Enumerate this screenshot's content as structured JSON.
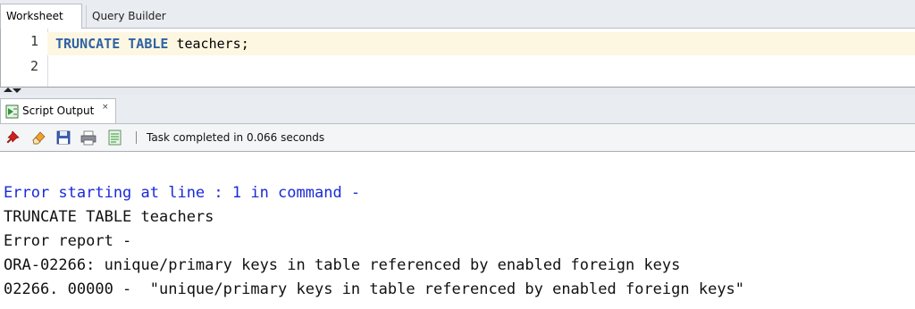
{
  "tabs": [
    {
      "label": "Worksheet",
      "active": true
    },
    {
      "label": "Query Builder",
      "active": false
    }
  ],
  "editor": {
    "lines": [
      {
        "number": "1",
        "keyword": "TRUNCATE TABLE",
        "rest": " teachers;"
      },
      {
        "number": "2",
        "keyword": "",
        "rest": ""
      }
    ]
  },
  "output_panel": {
    "tab_label": "Script Output",
    "close_label": "×",
    "toolbar_icons": [
      "pin-icon",
      "eraser-icon",
      "save-icon",
      "print-icon",
      "document-icon"
    ],
    "status": "Task completed in 0.066 seconds"
  },
  "output": {
    "lines": [
      "Error starting at line : 1 in command -",
      "TRUNCATE TABLE teachers",
      "Error report -",
      "ORA-02266: unique/primary keys in table referenced by enabled foreign keys",
      "02266. 00000 -  \"unique/primary keys in table referenced by enabled foreign keys\""
    ]
  },
  "colors": {
    "keyword": "#3062a4",
    "error_line": "#1a2ad6",
    "current_line": "#fdf7e2"
  }
}
